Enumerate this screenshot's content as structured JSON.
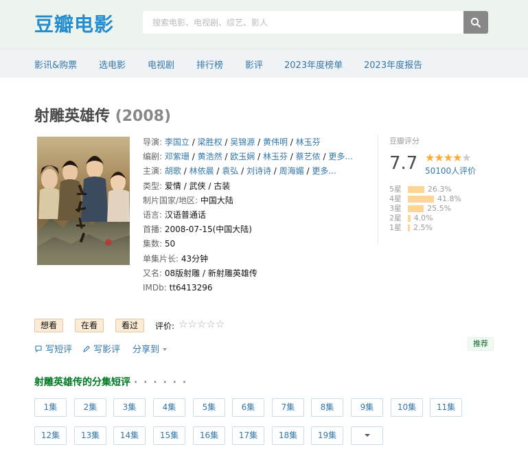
{
  "header": {
    "logo": "豆瓣电影",
    "search_placeholder": "搜索电影、电视剧、综艺、影人"
  },
  "nav": [
    "影讯&购票",
    "选电影",
    "电视剧",
    "排行榜",
    "影评",
    "2023年度榜单",
    "2023年度报告"
  ],
  "title": {
    "name": "射雕英雄传",
    "year": "(2008)"
  },
  "info": {
    "director_label": "导演",
    "directors": [
      "李国立",
      "梁胜权",
      "吴锦源",
      "黄伟明",
      "林玉芬"
    ],
    "writer_label": "编剧",
    "writers": [
      "邓紫珊",
      "黄浩然",
      "欧玉娴",
      "林玉芬",
      "蔡艺侬"
    ],
    "writer_more": "更多...",
    "cast_label": "主演",
    "cast": [
      "胡歌",
      "林依晨",
      "袁弘",
      "刘诗诗",
      "周海媚"
    ],
    "cast_more": "更多...",
    "genre_label": "类型:",
    "genre_value": "爱情 / 武侠 / 古装",
    "country_label": "制片国家/地区:",
    "country_value": "中国大陆",
    "language_label": "语言:",
    "language_value": "汉语普通话",
    "premiere_label": "首播:",
    "premiere_value": "2008-07-15(中国大陆)",
    "episodes_label": "集数:",
    "episodes_value": "50",
    "runtime_label": "单集片长:",
    "runtime_value": "43分钟",
    "aka_label": "又名:",
    "aka_value": "08版射雕 / 新射雕英雄传",
    "imdb_label": "IMDb:",
    "imdb_value": "tt6413296"
  },
  "rating": {
    "label": "豆瓣评分",
    "score": "7.7",
    "stars_filled": 4,
    "votes": "50100人评价",
    "distribution": [
      {
        "label": "5星",
        "percent": 26.3,
        "text": "26.3%"
      },
      {
        "label": "4星",
        "percent": 41.8,
        "text": "41.8%"
      },
      {
        "label": "3星",
        "percent": 25.5,
        "text": "25.5%"
      },
      {
        "label": "2星",
        "percent": 4.0,
        "text": "4.0%"
      },
      {
        "label": "1星",
        "percent": 2.5,
        "text": "2.5%"
      }
    ]
  },
  "interest": {
    "want": "想看",
    "doing": "在看",
    "done": "看过",
    "rate_label": "评价:"
  },
  "actions": {
    "short_review": "写短评",
    "review": "写影评",
    "share": "分享到",
    "recommend": "推荐"
  },
  "episodes_section": {
    "title": "射雕英雄传的分集短评",
    "dots": "· · · · · ·",
    "episodes": [
      "1集",
      "2集",
      "3集",
      "4集",
      "5集",
      "6集",
      "7集",
      "8集",
      "9集",
      "10集",
      "11集",
      "12集",
      "13集",
      "14集",
      "15集",
      "16集",
      "17集",
      "18集",
      "19集"
    ]
  },
  "colors": {
    "brand_blue": "#258dcd",
    "link": "#37a",
    "star": "#ffac2d",
    "bar": "#ffd596",
    "section_green": "#007722"
  }
}
